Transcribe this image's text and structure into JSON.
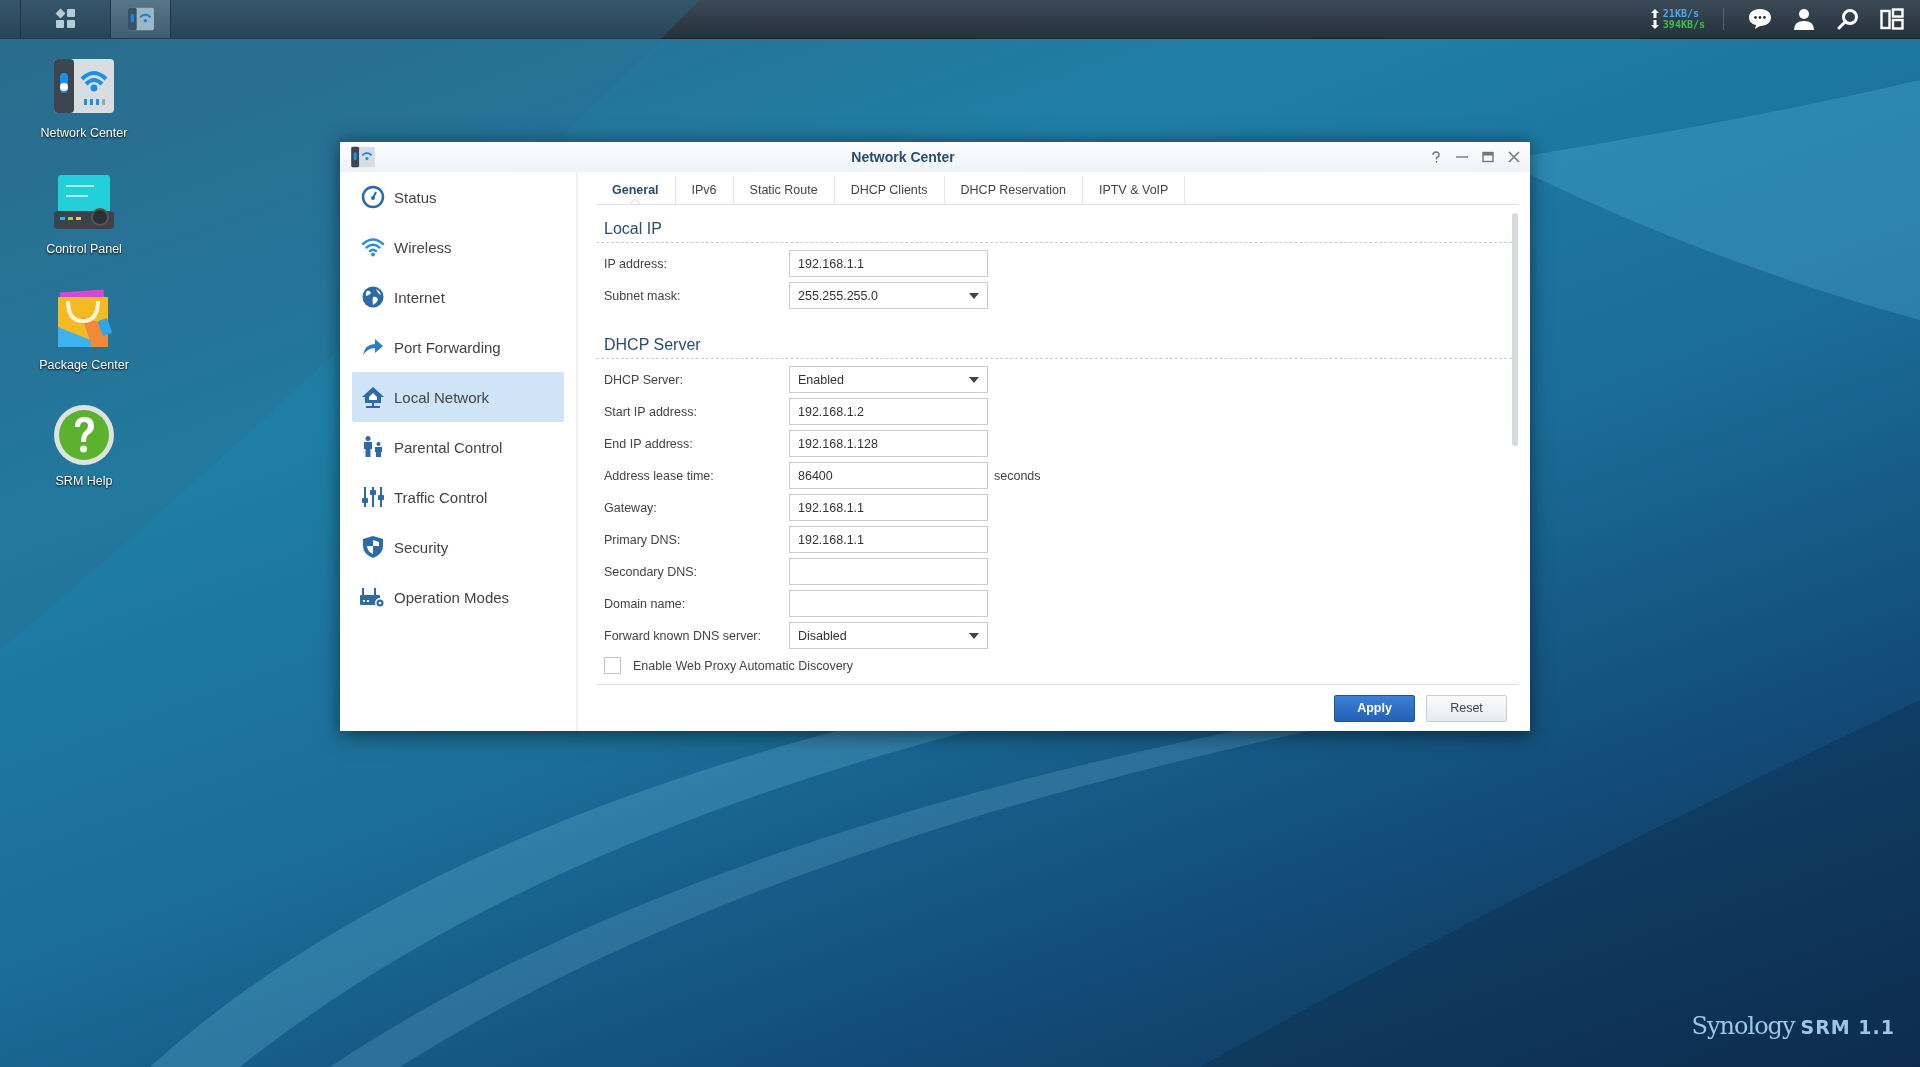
{
  "taskbar": {
    "buttons": [
      {
        "kind": "launcher",
        "selected": false
      },
      {
        "kind": "network",
        "selected": true
      }
    ],
    "upload_rate": "21KB/s",
    "download_rate": "394KB/s"
  },
  "desktop_icons": [
    {
      "kind": "network",
      "label": "Network Center"
    },
    {
      "kind": "control",
      "label": "Control Panel"
    },
    {
      "kind": "package",
      "label": "Package Center"
    },
    {
      "kind": "help",
      "label": "SRM Help"
    }
  ],
  "window": {
    "title": "Network Center",
    "sidebar": [
      {
        "kind": "gauge",
        "label": "Status",
        "selected": false
      },
      {
        "kind": "wifi",
        "label": "Wireless",
        "selected": false
      },
      {
        "kind": "globe",
        "label": "Internet",
        "selected": false
      },
      {
        "kind": "arrow",
        "label": "Port Forwarding",
        "selected": false
      },
      {
        "kind": "house",
        "label": "Local Network",
        "selected": true
      },
      {
        "kind": "people",
        "label": "Parental Control",
        "selected": false
      },
      {
        "kind": "sliders",
        "label": "Traffic Control",
        "selected": false
      },
      {
        "kind": "shield",
        "label": "Security",
        "selected": false
      },
      {
        "kind": "router",
        "label": "Operation Modes",
        "selected": false
      }
    ],
    "tabs": [
      {
        "label": "General",
        "selected": true
      },
      {
        "label": "IPv6",
        "selected": false
      },
      {
        "label": "Static Route",
        "selected": false
      },
      {
        "label": "DHCP Clients",
        "selected": false
      },
      {
        "label": "DHCP Reservation",
        "selected": false
      },
      {
        "label": "IPTV & VoIP",
        "selected": false
      }
    ],
    "sections": [
      {
        "title": "Local IP",
        "fields": [
          {
            "label": "IP address:",
            "kind": "text",
            "value": "192.168.1.1"
          },
          {
            "label": "Subnet mask:",
            "kind": "select",
            "value": "255.255.255.0"
          }
        ]
      },
      {
        "title": "DHCP Server",
        "fields": [
          {
            "label": "DHCP Server:",
            "kind": "select",
            "value": "Enabled"
          },
          {
            "label": "Start IP address:",
            "kind": "text",
            "value": "192.168.1.2"
          },
          {
            "label": "End IP address:",
            "kind": "text",
            "value": "192.168.1.128"
          },
          {
            "label": "Address lease time:",
            "kind": "text",
            "value": "86400",
            "unit": "seconds"
          },
          {
            "label": "Gateway:",
            "kind": "text",
            "value": "192.168.1.1"
          },
          {
            "label": "Primary DNS:",
            "kind": "text",
            "value": "192.168.1.1"
          },
          {
            "label": "Secondary DNS:",
            "kind": "text"
          },
          {
            "label": "Domain name:",
            "kind": "text"
          },
          {
            "label": "Forward known DNS server:",
            "kind": "select",
            "value": "Disabled"
          }
        ]
      }
    ],
    "checkbox": {
      "label": "Enable Web Proxy Automatic Discovery",
      "checked": false
    },
    "buttons": [
      {
        "label": "Apply",
        "kind": "primary"
      },
      {
        "label": "Reset",
        "kind": "secondary"
      }
    ]
  },
  "branding": {
    "brand": "Synology",
    "product": "SRM 1.1"
  }
}
